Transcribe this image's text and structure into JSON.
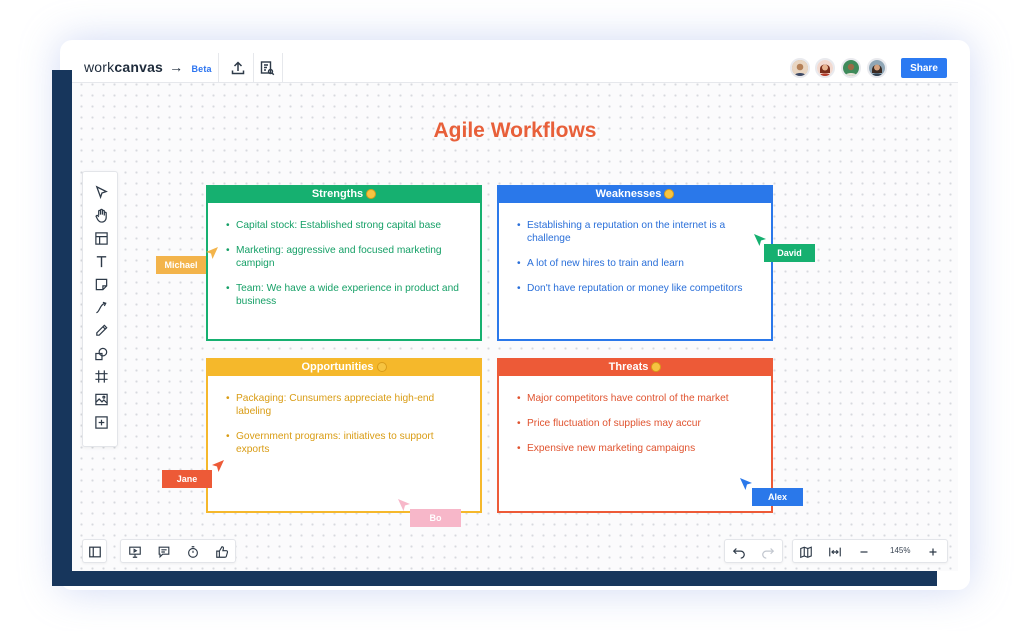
{
  "app": {
    "logo_prefix": "work",
    "logo_strong": "canvas",
    "logo_arrow": "→",
    "logo_beta": "Beta",
    "share_label": "Share"
  },
  "icons": {
    "topbar": [
      "upload-icon",
      "report-icon"
    ],
    "tools": [
      "select-icon",
      "hand-icon",
      "template-icon",
      "text-icon",
      "sticky-note-icon",
      "connector-icon",
      "pen-icon",
      "shapes-icon",
      "frame-icon",
      "image-icon",
      "add-icon"
    ],
    "bottom_left": [
      "sidebar-icon",
      "present-icon",
      "comment-icon",
      "timer-icon",
      "like-icon"
    ],
    "bottom_right": [
      "undo-icon",
      "redo-icon",
      "map-icon",
      "fit-width-icon",
      "zoom-out-icon",
      "zoom-in-icon"
    ]
  },
  "zoom_level": "145%",
  "board": {
    "title": "Agile Workflows",
    "cards": [
      {
        "title": "Strengths",
        "color": "#16b070",
        "items": [
          "Capital stock: Established strong capital base",
          "Marketing: aggressive and focused marketing campign",
          "Team: We have a wide experience in product and business"
        ]
      },
      {
        "title": "Weaknesses",
        "color": "#2a78ea",
        "items": [
          "Establishing a reputation on the internet is a challenge",
          "A lot of new hires to train and learn",
          "Don't have reputation or money like competitors"
        ]
      },
      {
        "title": "Opportunities",
        "color": "#f5b82b",
        "items": [
          "Packaging: Cunsumers appreciate high-end labeling",
          "Government programs: initiatives to support exports"
        ]
      },
      {
        "title": "Threats",
        "color": "#ed5a37",
        "items": [
          "Major competitors have control of the market",
          "Price fluctuation of supplies may accur",
          "Expensive new marketing campaigns"
        ]
      }
    ],
    "cursors": [
      {
        "name": "Michael",
        "color": "#f3b44b"
      },
      {
        "name": "David",
        "color": "#16b070"
      },
      {
        "name": "Jane",
        "color": "#ed5a37"
      },
      {
        "name": "Bo",
        "color": "#f7b7c9"
      },
      {
        "name": "Alex",
        "color": "#2a78ea"
      }
    ]
  }
}
